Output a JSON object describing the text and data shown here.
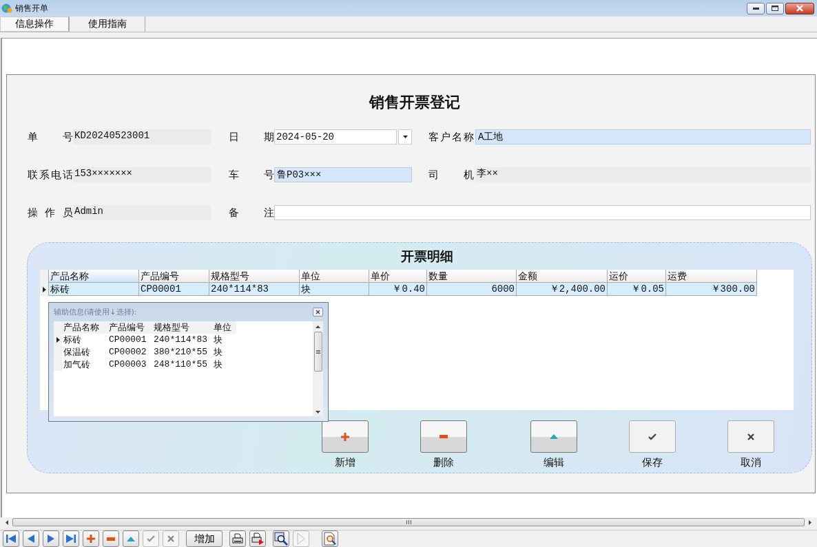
{
  "window": {
    "title": "销售开单"
  },
  "tabs": [
    {
      "label": "信息操作",
      "selected": true
    },
    {
      "label": "使用指南",
      "selected": false
    }
  ],
  "form": {
    "title": "销售开票登记",
    "rows": [
      [
        {
          "label": "单 号",
          "kind": "display",
          "value": "KD20240523001"
        },
        {
          "label": "日 期",
          "kind": "date",
          "value": "2024-05-20"
        },
        {
          "label": "客户名称",
          "kind": "input",
          "value": "A工地",
          "highlighted": true
        }
      ],
      [
        {
          "label": "联系电话",
          "kind": "display",
          "value": "153×××××××"
        },
        {
          "label": "车 号",
          "kind": "input",
          "value": "鲁P03×××",
          "highlighted": true
        },
        {
          "label": "司 机",
          "kind": "display",
          "value": "李××"
        }
      ],
      [
        {
          "label": "操 作 员",
          "kind": "display",
          "value": "Admin"
        },
        {
          "label": "备 注",
          "kind": "input",
          "highlighted": false
        }
      ]
    ]
  },
  "detail": {
    "title": "开票明细",
    "columns": [
      {
        "label": "产品名称",
        "numeric": false
      },
      {
        "label": "产品编号",
        "numeric": false
      },
      {
        "label": "规格型号",
        "numeric": false
      },
      {
        "label": "单位",
        "numeric": false
      },
      {
        "label": "单价",
        "numeric": true
      },
      {
        "label": "数量",
        "numeric": true
      },
      {
        "label": "金额",
        "numeric": true
      },
      {
        "label": "运价",
        "numeric": true
      },
      {
        "label": "运费",
        "numeric": true
      }
    ],
    "rows": [
      {
        "selected": true,
        "cells": [
          "标砖",
          "CP00001",
          "240*114*83",
          "块",
          "￥0.40",
          "6000",
          "￥2,400.00",
          "￥0.05",
          "￥300.00"
        ]
      }
    ],
    "popup": {
      "title": "辅助信息(请使用↓选择):",
      "columns": [
        "产品名称",
        "产品编号",
        "规格型号",
        "单位"
      ],
      "rows": [
        {
          "selected": true,
          "cells": [
            "标砖",
            "CP00001",
            "240*114*83",
            "块"
          ]
        },
        {
          "selected": false,
          "cells": [
            "保温砖",
            "CP00002",
            "380*210*55",
            "块"
          ]
        },
        {
          "selected": false,
          "cells": [
            "加气砖",
            "CP00003",
            "248*110*55",
            "块"
          ]
        }
      ]
    },
    "actions": [
      {
        "label": "新增",
        "kind": "add",
        "disabled": false
      },
      {
        "label": "删除",
        "kind": "remove",
        "disabled": false
      },
      {
        "label": "编辑",
        "kind": "up",
        "disabled": false
      },
      {
        "label": "保存",
        "kind": "check",
        "disabled": true
      },
      {
        "label": "取消",
        "kind": "cancel",
        "disabled": true
      }
    ]
  },
  "toolbar": [
    [
      {
        "kind": "first",
        "disabled": false
      },
      {
        "kind": "prev",
        "disabled": false
      },
      {
        "kind": "next",
        "disabled": false
      },
      {
        "kind": "last",
        "disabled": false
      },
      {
        "kind": "add",
        "disabled": false
      },
      {
        "kind": "remove",
        "disabled": false
      },
      {
        "kind": "up",
        "disabled": false
      },
      {
        "kind": "check",
        "disabled": true
      },
      {
        "kind": "cancel",
        "disabled": true
      }
    ],
    [
      {
        "kind": "text",
        "label": "增加",
        "disabled": false
      }
    ],
    [
      {
        "kind": "print",
        "disabled": false
      },
      {
        "kind": "print-send",
        "disabled": false
      }
    ],
    [
      {
        "kind": "preview",
        "disabled": false
      },
      {
        "kind": "play",
        "disabled": true
      }
    ],
    [
      {
        "kind": "page-search",
        "disabled": false
      }
    ]
  ]
}
